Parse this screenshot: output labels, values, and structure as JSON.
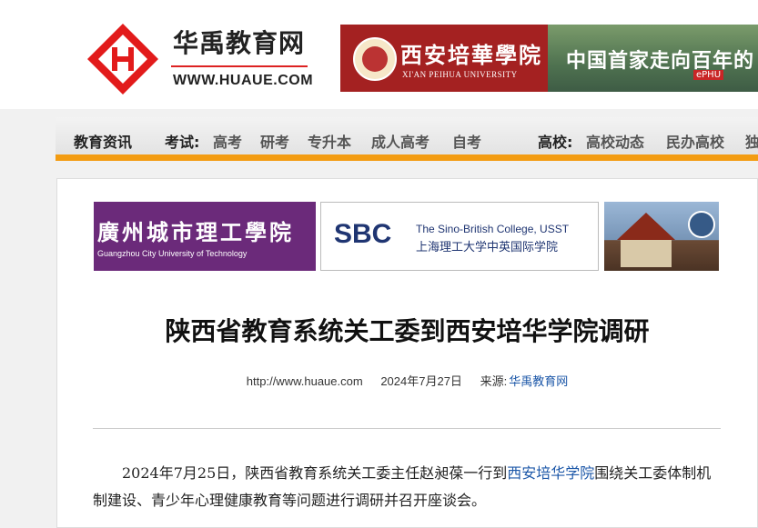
{
  "header": {
    "site_name": "华禹教育网",
    "site_url": "WWW.HUAUE.COM",
    "logo_icon": "huaue-logo-icon",
    "banner": {
      "cn": "西安培華學院",
      "en": "XI'AN PEIHUA UNIVERSITY",
      "slogan": "中国首家走向百年的",
      "badge": "ePHU"
    }
  },
  "nav": {
    "news": "教育资讯",
    "exam_label": "考试:",
    "exam_items": [
      "高考",
      "研考",
      "专升本",
      "成人高考",
      "自考"
    ],
    "college_label": "高校:",
    "college_items": [
      "高校动态",
      "民办高校",
      "独"
    ]
  },
  "ads": {
    "ad1_cn": "廣州城市理工學院",
    "ad1_en": "Guangzhou City University of Technology",
    "ad2_logo": "SBC",
    "ad2_en": "The Sino-British College, USST",
    "ad2_cn": "上海理工大学中英国际学院"
  },
  "article": {
    "title": "陕西省教育系统关工委到西安培华学院调研",
    "url": "http://www.huaue.com",
    "date": "2024年7月27日",
    "source_label": "来源:",
    "source": "华禹教育网",
    "para_before": "2024年7月25日，陕西省教育系统关工委主任赵昶葆一行到",
    "para_link": "西安培华学院",
    "para_after": "围绕关工委体制机制建设、青少年心理健康教育等问题进行调研并召开座谈会。"
  },
  "colors": {
    "accent": "#f39c12",
    "brand_red": "#d22",
    "link": "#1c57a8"
  }
}
